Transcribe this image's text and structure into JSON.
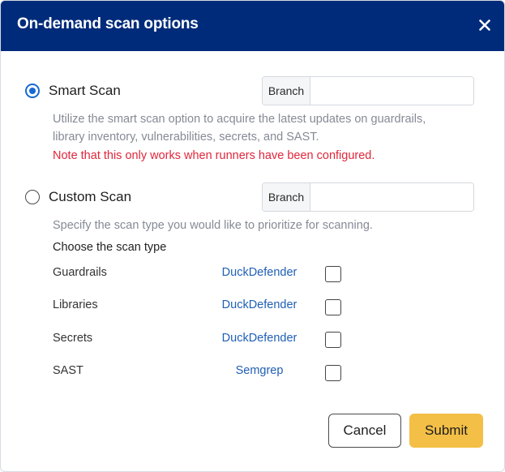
{
  "modal": {
    "title": "On-demand scan options",
    "close_icon": "close-icon"
  },
  "smart_scan": {
    "label": "Smart Scan",
    "selected": true,
    "branch_addon": "Branch",
    "branch_value": "",
    "description_line1": "Utilize the smart scan option to acquire the latest updates on guardrails,",
    "description_line2": "library inventory, vulnerabilities, secrets, and SAST.",
    "note": "Note that this only works when runners have been configured."
  },
  "custom_scan": {
    "label": "Custom Scan",
    "selected": false,
    "branch_addon": "Branch",
    "branch_value": "",
    "description": "Specify the scan type you would like to prioritize for scanning.",
    "choose_label": "Choose the scan type",
    "scan_types": [
      {
        "name": "Guardrails",
        "tool": "DuckDefender",
        "checked": false
      },
      {
        "name": "Libraries",
        "tool": "DuckDefender",
        "checked": false
      },
      {
        "name": "Secrets",
        "tool": "DuckDefender",
        "checked": false
      },
      {
        "name": "SAST",
        "tool": "Semgrep",
        "checked": false
      }
    ]
  },
  "footer": {
    "cancel_label": "Cancel",
    "submit_label": "Submit"
  },
  "colors": {
    "header_bg": "#002b7a",
    "accent_radio": "#1769d3",
    "note_red": "#e0263b",
    "link_blue": "#1f5fb5",
    "submit_yellow": "#f3bf46"
  }
}
